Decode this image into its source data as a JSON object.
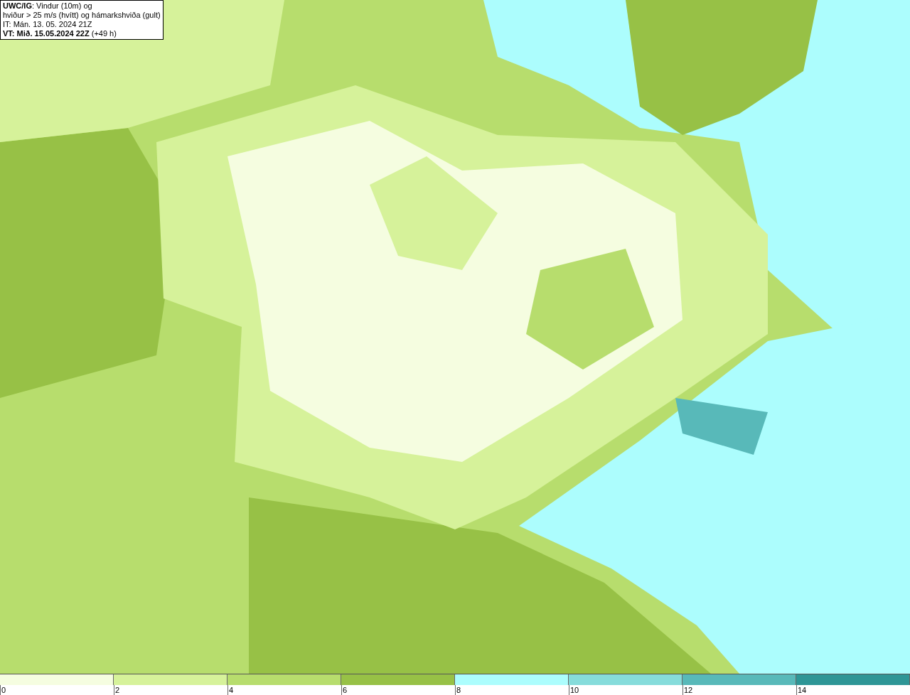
{
  "title_box": {
    "lines": [
      "**UWC/IG**: Vindur (10m) og",
      "hviður > 25 m/s (hvítt) og hámarkshviða (gult)",
      "IT: Mán. 13. 05. 2024 21Z",
      "**VT: Mið. 15.05.2024 22Z** (+49 h)"
    ]
  },
  "legend": {
    "segments": [
      {
        "color": "#f5fde0"
      },
      {
        "color": "#d6f29a"
      },
      {
        "color": "#b7dd6d"
      },
      {
        "color": "#97c146"
      },
      {
        "color": "#acfdfd"
      },
      {
        "color": "#86dcdb"
      },
      {
        "color": "#58b9b9"
      },
      {
        "color": "#2e9696"
      }
    ],
    "ticks": [
      "0",
      "2",
      "4",
      "6",
      "8",
      "10",
      "12",
      "14"
    ]
  }
}
